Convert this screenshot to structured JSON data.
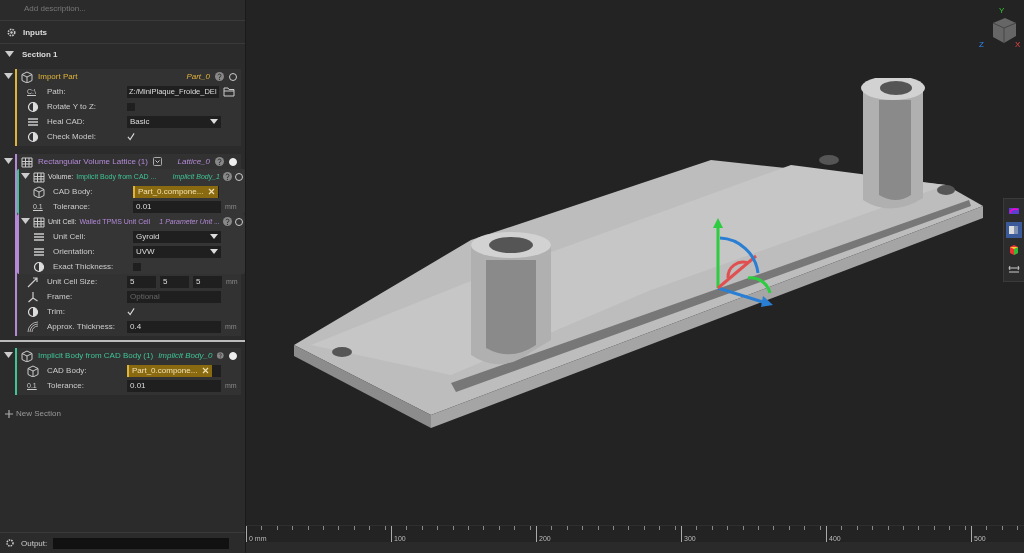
{
  "description": {
    "placeholder": "Add description..."
  },
  "inputs": {
    "title": "Inputs"
  },
  "section": {
    "title": "Section 1",
    "expanded": true,
    "blocks": [
      {
        "title": "Import Part",
        "output": "Part_0",
        "color": "#e0b33a",
        "expanded": true,
        "active": false,
        "fields": [
          {
            "kind": "text",
            "icon_text": "C:\\",
            "label": "Path:",
            "value": "Z:/MiniPlaque_Froide_DEI"
          },
          {
            "kind": "checkbox",
            "label": "Rotate Y to Z:",
            "checked": false
          },
          {
            "kind": "dropdown",
            "label": "Heal CAD:",
            "value": "Basic"
          },
          {
            "kind": "checkbox",
            "label": "Check Model:",
            "checked": true
          }
        ]
      },
      {
        "title": "Rectangular Volume Lattice (1)",
        "output": "Lattice_0",
        "color": "#b48ad8",
        "expanded": true,
        "active": true,
        "fields": [
          {
            "kind": "sub",
            "title": "Volume:",
            "type": "Implicit Body from CAD ...",
            "output": "Implicit Body_1",
            "color": "#3fc495",
            "expanded": true,
            "fields": [
              {
                "kind": "tag",
                "label": "CAD Body:",
                "value": "Part_0.compone..."
              },
              {
                "kind": "number",
                "icon_text": "0.1",
                "label": "Tolerance:",
                "value": "0.01",
                "unit": "mm"
              }
            ]
          },
          {
            "kind": "sub",
            "title": "Unit Cell:",
            "type": "Walled TPMS Unit Cell",
            "output": "1 Parameter Unit ...",
            "color": "#b48ad8",
            "expanded": true,
            "fields": [
              {
                "kind": "dropdown",
                "label": "Unit Cell:",
                "value": "Gyroid"
              },
              {
                "kind": "dropdown",
                "label": "Orientation:",
                "value": "UVW"
              },
              {
                "kind": "checkbox",
                "label": "Exact Thickness:",
                "checked": false
              }
            ]
          },
          {
            "kind": "triple",
            "label": "Unit Cell Size:",
            "values": [
              "5",
              "5",
              "5"
            ],
            "unit": "mm"
          },
          {
            "kind": "number",
            "label": "Frame:",
            "placeholder": "Optional"
          },
          {
            "kind": "checkbox",
            "label": "Trim:",
            "checked": true
          },
          {
            "kind": "number",
            "label": "Approx. Thickness:",
            "value": "0.4",
            "unit": "mm"
          }
        ]
      },
      {
        "title": "Implicit Body from CAD Body (1)",
        "output": "Implicit Body_0",
        "color": "#3fc495",
        "expanded": true,
        "active": true,
        "fields": [
          {
            "kind": "tag",
            "label": "CAD Body:",
            "value": "Part_0.compone..."
          },
          {
            "kind": "number",
            "icon_text": "0.1",
            "label": "Tolerance:",
            "value": "0.01",
            "unit": "mm"
          }
        ]
      }
    ]
  },
  "new_section": "New Section",
  "output": {
    "label": "Output:"
  },
  "view_cube": {
    "axes": [
      "Y",
      "Z",
      "X"
    ]
  },
  "toolbar": [
    {
      "selected": false
    },
    {
      "selected": true
    },
    {
      "selected": false
    },
    {
      "selected": false
    }
  ],
  "ruler": [
    "0 mm",
    "100",
    "200",
    "300",
    "400",
    "500"
  ]
}
